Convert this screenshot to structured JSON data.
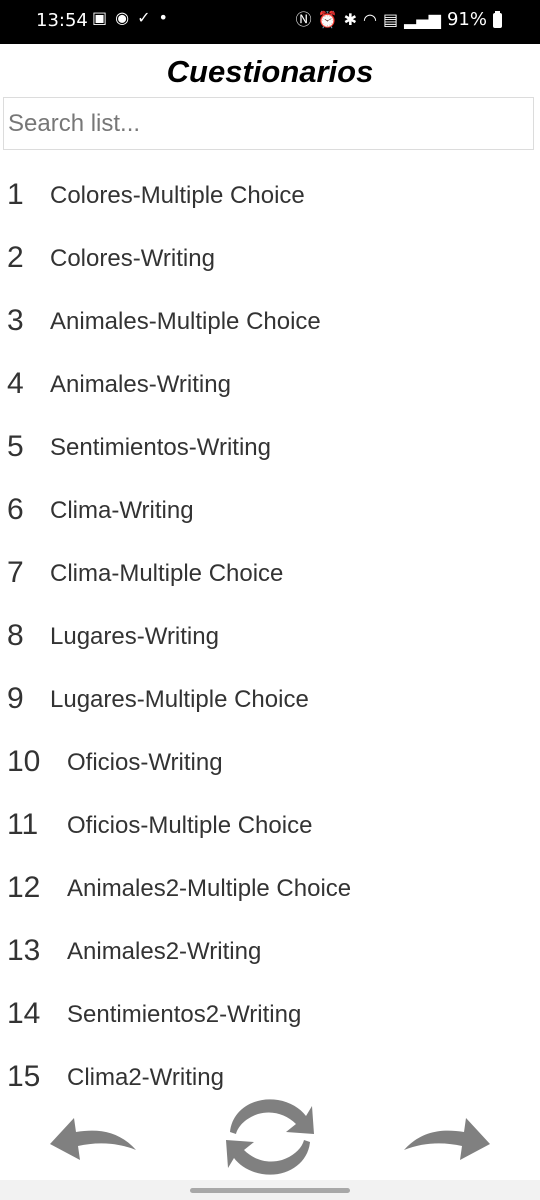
{
  "status_bar": {
    "time": "13:54",
    "battery": "91%"
  },
  "header": {
    "title": "Cuestionarios"
  },
  "search": {
    "placeholder": "Search list..."
  },
  "items": [
    {
      "number": "1",
      "label": "Colores-Multiple Choice"
    },
    {
      "number": "2",
      "label": "Colores-Writing"
    },
    {
      "number": "3",
      "label": "Animales-Multiple Choice"
    },
    {
      "number": "4",
      "label": "Animales-Writing"
    },
    {
      "number": "5",
      "label": "Sentimientos-Writing"
    },
    {
      "number": "6",
      "label": "Clima-Writing"
    },
    {
      "number": "7",
      "label": "Clima-Multiple Choice"
    },
    {
      "number": "8",
      "label": "Lugares-Writing"
    },
    {
      "number": "9",
      "label": "Lugares-Multiple Choice"
    },
    {
      "number": "10",
      "label": "Oficios-Writing"
    },
    {
      "number": "11",
      "label": "Oficios-Multiple Choice"
    },
    {
      "number": "12",
      "label": "Animales2-Multiple Choice"
    },
    {
      "number": "13",
      "label": "Animales2-Writing"
    },
    {
      "number": "14",
      "label": "Sentimientos2-Writing"
    },
    {
      "number": "15",
      "label": "Clima2-Writing"
    }
  ],
  "icons": {
    "back": "back-arrow-icon",
    "refresh": "refresh-icon",
    "forward": "forward-arrow-icon"
  },
  "colors": {
    "icon_gray": "#808080",
    "status_bar": "#000000"
  }
}
